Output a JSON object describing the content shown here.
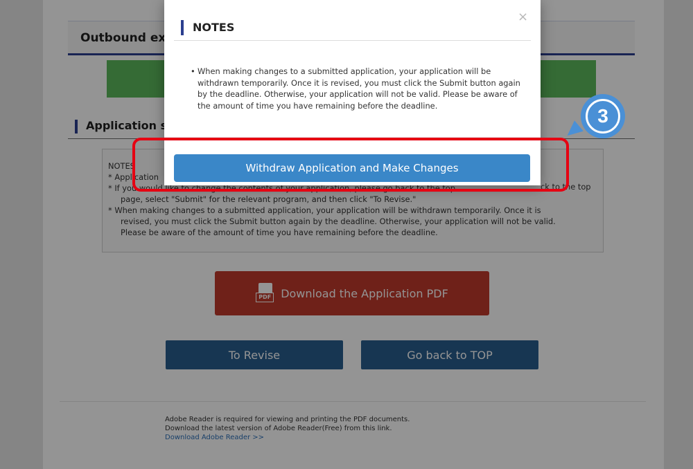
{
  "page": {
    "outbound_heading": "Outbound exchange",
    "application_heading": "Application status",
    "notes_box": {
      "title": "NOTES",
      "line1": "* Application",
      "line2": "* If you would like to change the contents of your application, please go back to the top",
      "line3": "page, select \"Submit\" for the relevant program, and then click \"To Revise.\"",
      "line4": "* When making changes to a submitted application, your application will be withdrawn temporarily. Once it is",
      "line5": "revised, you must click the Submit button again by the deadline. Otherwise, your application will not be valid.",
      "line6": "Please be aware of the amount of time you have remaining before the deadline."
    },
    "tail_text": "ck to the top",
    "download_pdf_label": "Download the Application PDF",
    "pdf_icon_text": "PDF",
    "to_revise_label": "To Revise",
    "go_back_top_label": "Go back to TOP",
    "footer": {
      "line1": "Adobe Reader is required for viewing and printing the PDF documents.",
      "line2": "Download the latest version of Adobe Reader(Free) from this link.",
      "link": "Download Adobe Reader >>"
    }
  },
  "modal": {
    "title": "NOTES",
    "close_symbol": "×",
    "bullet": "•",
    "body": "When making changes to a submitted application, your application will be withdrawn temporarily. Once it is revised, you must click the Submit button again by the deadline. Otherwise, your application will not be valid. Please be aware of the amount of time you have remaining before the deadline.",
    "action_label": "Withdraw Application and Make Changes"
  },
  "annotation": {
    "step_number": "3",
    "outline_color": "#e60012",
    "circle_color": "#4a90d6"
  },
  "colors": {
    "accent_navy": "#2b3f8f",
    "green_bar": "#5cb85c",
    "pdf_button": "#c0392b",
    "nav_button": "#285e8e",
    "modal_button": "#3a87c8"
  },
  "icons": {
    "pdf": "pdf-file-icon",
    "close": "close-icon"
  }
}
